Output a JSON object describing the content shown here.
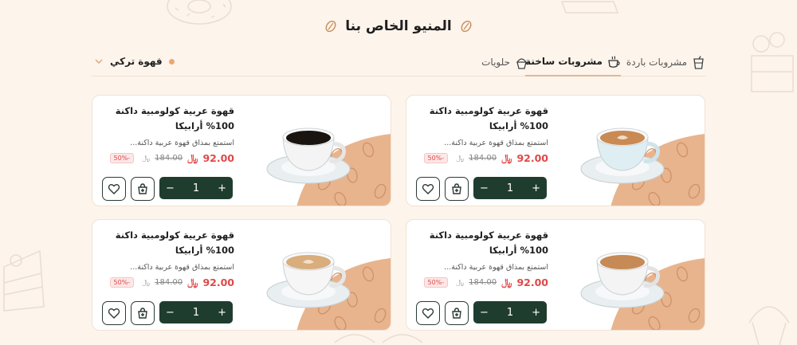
{
  "header": {
    "title": "المنيو الخاص بنا"
  },
  "tabs": [
    {
      "label": "مشروبات باردة",
      "icon": "cold-drink-icon"
    },
    {
      "label": "مشروبات ساخنة",
      "icon": "hot-drink-icon",
      "active": true
    },
    {
      "label": "حلويات",
      "icon": "cupcake-icon"
    }
  ],
  "filter": {
    "selected": "قهوة تركي"
  },
  "products": [
    {
      "name": "قهوة عربية كولومبية داكنة 100% أرابيكا",
      "desc": "استمتع بمذاق قهوة عربية داكنة...",
      "price": "92.00",
      "old_price": "184.00",
      "discount": "-50%",
      "qty": "1"
    },
    {
      "name": "قهوة عربية كولومبية داكنة 100% أرابيكا",
      "desc": "استمتع بمذاق قهوة عربية داكنة...",
      "price": "92.00",
      "old_price": "184.00",
      "discount": "-50%",
      "qty": "1"
    },
    {
      "name": "قهوة عربية كولومبية داكنة 100% أرابيكا",
      "desc": "استمتع بمذاق قهوة عربية داكنة...",
      "price": "92.00",
      "old_price": "184.00",
      "discount": "-50%",
      "qty": "1"
    },
    {
      "name": "قهوة عربية كولومبية داكنة 100% أرابيكا",
      "desc": "استمتع بمذاق قهوة عربية داكنة...",
      "price": "92.00",
      "old_price": "184.00",
      "discount": "-50%",
      "qty": "1"
    }
  ],
  "currency_symbol": "riyal-symbol-icon",
  "colors": {
    "accent": "#e8a873",
    "primary": "#1f3d2f",
    "price": "#e04848",
    "background": "#fdf4ec"
  }
}
